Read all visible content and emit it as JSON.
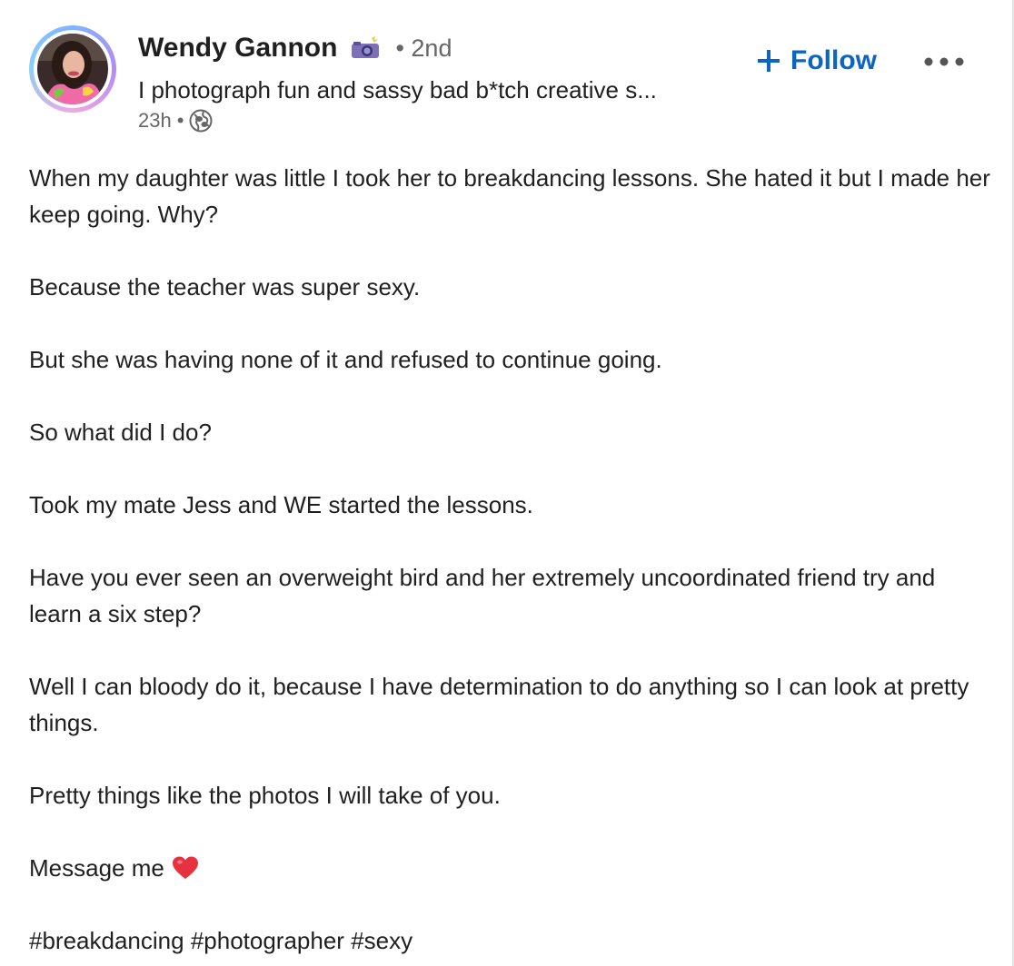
{
  "post": {
    "author": {
      "name": "Wendy Gannon",
      "badge_icon": "camera-with-flash-icon",
      "degree": "• 2nd",
      "headline": "I photograph fun and sassy bad b*tch creative s...",
      "time": "23h",
      "meta_separator": "•",
      "visibility_icon": "globe-icon"
    },
    "follow_label": "Follow",
    "more_icon": "ellipsis-icon",
    "accent_color": "#0a66c2",
    "paragraphs": [
      "When my daughter was little I took her to breakdancing lessons. She hated it but I made her keep going. Why?",
      "Because the teacher was super sexy.",
      "But she was having none of it and refused to continue going.",
      "So what did I do?",
      "Took my mate Jess and WE started the lessons.",
      "Have you ever seen an overweight bird and her extremely uncoordinated friend try and learn a six step?",
      "Well I can bloody do it, because I have determination to do anything so I can look at pretty things.",
      "Pretty things like the photos I will take of you."
    ],
    "closing": {
      "text": "Message me",
      "emoji_icon": "red-heart-icon"
    },
    "hashtags": [
      "#breakdancing",
      "#photographer",
      "#sexy"
    ]
  }
}
